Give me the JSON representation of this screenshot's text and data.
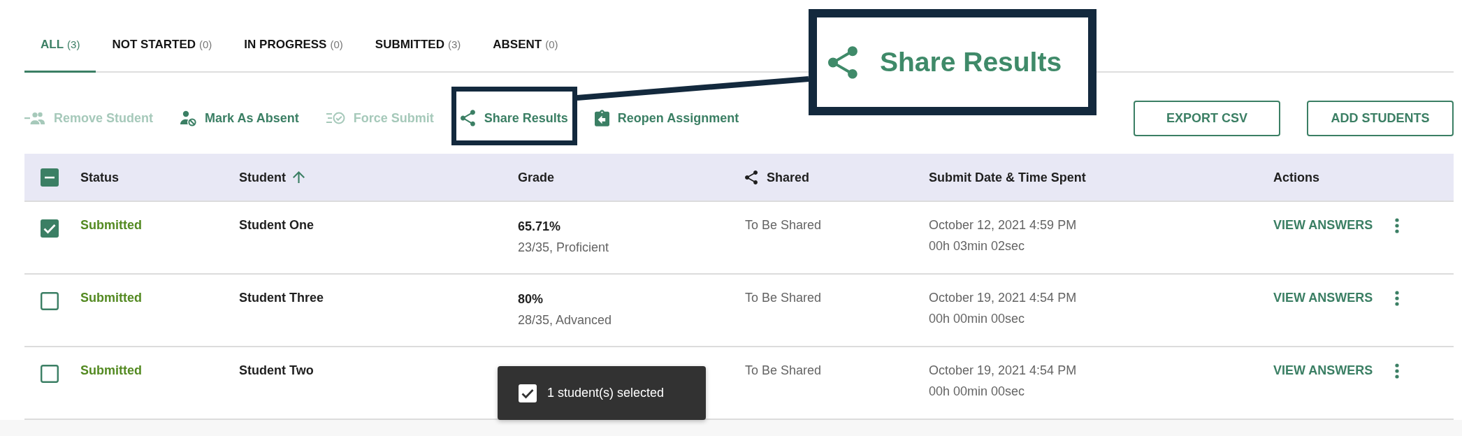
{
  "tabs": [
    {
      "label": "ALL",
      "count": "(3)",
      "selected": true
    },
    {
      "label": "NOT STARTED",
      "count": "(0)",
      "selected": false
    },
    {
      "label": "IN PROGRESS",
      "count": "(0)",
      "selected": false
    },
    {
      "label": "SUBMITTED",
      "count": "(3)",
      "selected": false
    },
    {
      "label": "ABSENT",
      "count": "(0)",
      "selected": false
    }
  ],
  "toolbar": {
    "actions": [
      {
        "label": "Remove Student",
        "disabled": true,
        "highlighted": false
      },
      {
        "label": "Mark As Absent",
        "disabled": false,
        "highlighted": false
      },
      {
        "label": "Force Submit",
        "disabled": true,
        "highlighted": false
      },
      {
        "label": "Share Results",
        "disabled": false,
        "highlighted": true
      },
      {
        "label": "Reopen Assignment",
        "disabled": false,
        "highlighted": false
      }
    ],
    "buttons": [
      {
        "label": "EXPORT CSV"
      },
      {
        "label": "ADD STUDENTS"
      }
    ]
  },
  "callout": {
    "label": "Share Results"
  },
  "table": {
    "select_all": {
      "indeterminate": true
    },
    "columns": [
      {
        "label": "Status",
        "sorted": false
      },
      {
        "label": "Student",
        "sorted": true
      },
      {
        "label": "Grade",
        "sorted": false
      },
      {
        "label": "Shared",
        "sorted": false
      },
      {
        "label": "Submit Date & Time Spent",
        "sorted": false
      },
      {
        "label": "Actions",
        "sorted": false
      }
    ],
    "rows": [
      {
        "selected": true,
        "status": "Submitted",
        "student": "Student One",
        "grade": "65.71%",
        "grade_detail": "23/35, Proficient",
        "shared": "To Be Shared",
        "submit_date": "October 12, 2021 4:59 PM",
        "time_spent": "00h 03min 02sec",
        "action": "VIEW ANSWERS"
      },
      {
        "selected": false,
        "status": "Submitted",
        "student": "Student Three",
        "grade": "80%",
        "grade_detail": "28/35, Advanced",
        "shared": "To Be Shared",
        "submit_date": "October 19, 2021 4:54 PM",
        "time_spent": "00h 00min 00sec",
        "action": "VIEW ANSWERS"
      },
      {
        "selected": false,
        "status": "Submitted",
        "student": "Student Two",
        "shared": "To Be Shared",
        "submit_date": "October 19, 2021 4:54 PM",
        "time_spent": "00h 00min 00sec",
        "action": "VIEW ANSWERS"
      }
    ]
  },
  "toast": {
    "text": "1 student(s) selected",
    "checked": true
  }
}
